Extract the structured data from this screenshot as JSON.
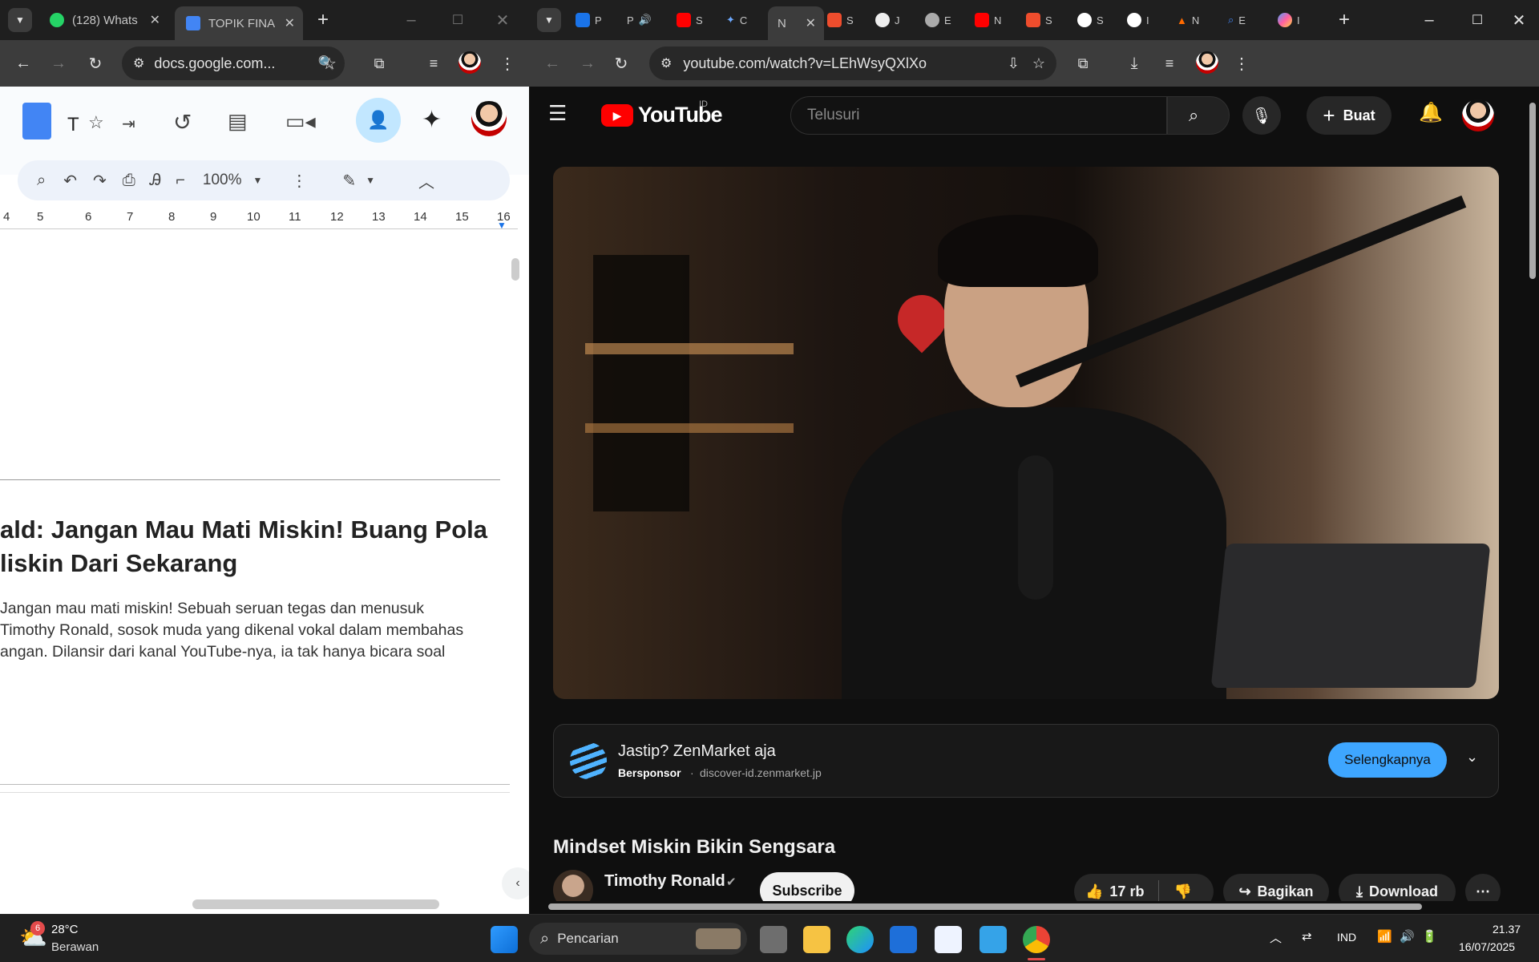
{
  "left_window": {
    "tabs": [
      {
        "label": "(128) Whats",
        "icon": "whatsapp-icon"
      },
      {
        "label": "TOPIK FINA",
        "icon": "docs-icon"
      }
    ],
    "url": "docs.google.com...",
    "doc_title_initial": "T",
    "zoom": "100%",
    "ruler_ticks": [
      "4",
      "5",
      "6",
      "7",
      "8",
      "9",
      "10",
      "11",
      "12",
      "13",
      "14",
      "15",
      "16"
    ],
    "heading_line1": "ald: Jangan Mau Mati Miskin! Buang Pola",
    "heading_line2": "liskin Dari Sekarang",
    "para_line1": " Jangan mau mati miskin! Sebuah seruan tegas dan menusuk",
    "para_line2": " Timothy Ronald, sosok muda yang dikenal vokal dalam membahas",
    "para_line3": "angan. Dilansir dari kanal YouTube-nya, ia tak hanya bicara soal"
  },
  "right_window": {
    "tab_labels": [
      "P",
      "P",
      "",
      "S",
      "C",
      "",
      "N",
      "S",
      "J",
      "E",
      "",
      "N",
      "S",
      "S",
      "I",
      "N",
      "E",
      "I"
    ],
    "active_tab_label": "N",
    "url": "youtube.com/watch?v=LEhWsyQXlXo",
    "youtube": {
      "logo": "YouTube",
      "region": "ID",
      "search_placeholder": "Telusuri",
      "create_label": "Buat",
      "ad_title": "Jastip? ZenMarket aja",
      "ad_sponsor": "Bersponsor",
      "ad_domain": "discover-id.zenmarket.jp",
      "ad_cta": "Selengkapnya",
      "video_title": "Mindset Miskin Bikin Sengsara",
      "channel": "Timothy Ronald",
      "subscribe": "Subscribe",
      "likes": "17 rb",
      "share": "Bagikan",
      "download": "Download"
    }
  },
  "taskbar": {
    "weather_temp": "28°C",
    "weather_desc": "Berawan",
    "weather_badge": "6",
    "search_placeholder": "Pencarian",
    "lang": "IND",
    "time": "21.37",
    "date": "16/07/2025"
  }
}
